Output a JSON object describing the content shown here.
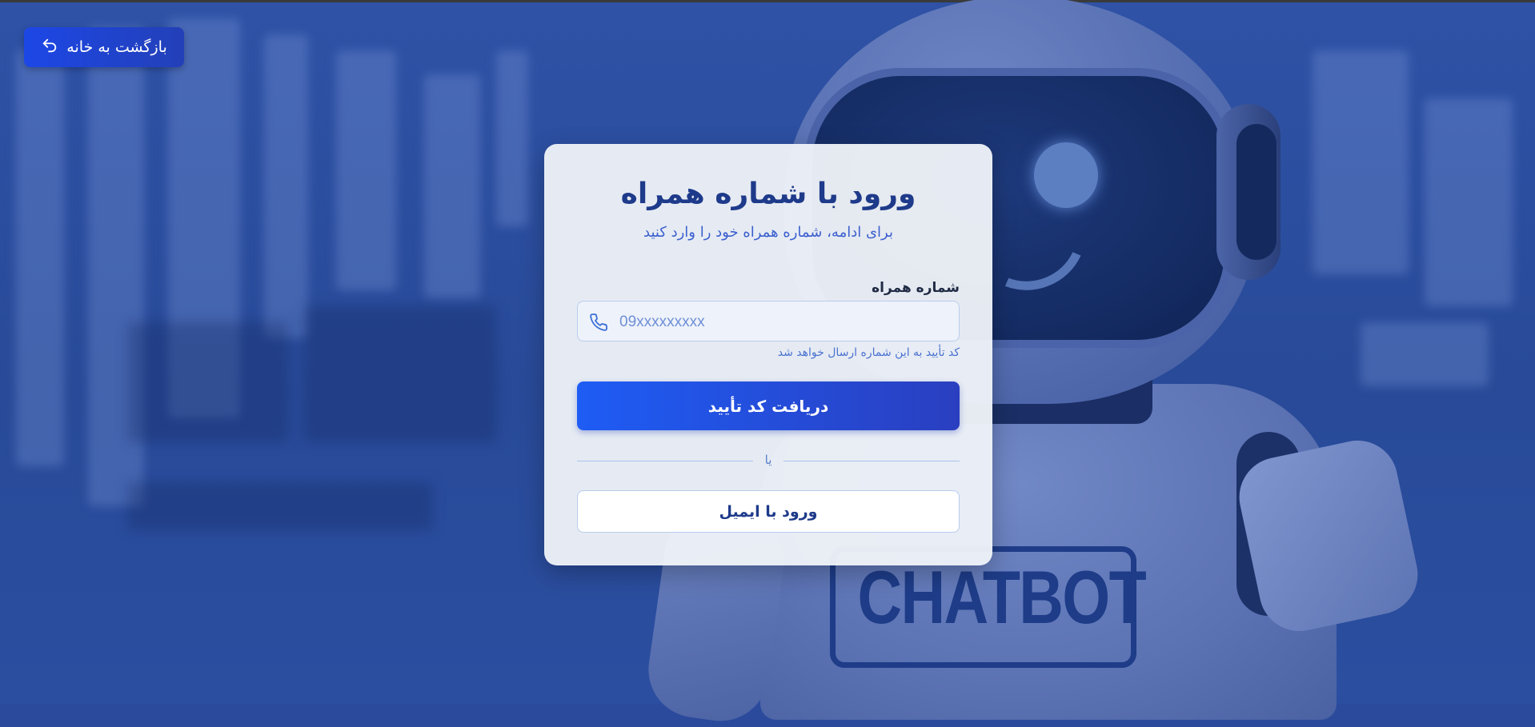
{
  "nav": {
    "back_label": "بازگشت به خانه",
    "back_icon": "undo-arrow-icon"
  },
  "login": {
    "title": "ورود با شماره همراه",
    "subtitle": "برای ادامه، شماره همراه خود را وارد کنید",
    "phone_label": "شماره همراه",
    "phone_placeholder": "09xxxxxxxxx",
    "phone_value": "",
    "phone_icon": "phone-icon",
    "hint": "کد تأیید به این شماره ارسال خواهد شد",
    "submit_label": "دریافت کد تأیید",
    "divider_label": "یا",
    "email_login_label": "ورود با ایمیل"
  },
  "background": {
    "robot_plate_text": "CHATBOT"
  },
  "colors": {
    "primary": "#1e5cf5",
    "primary_dark": "#2a3fc0",
    "title": "#1e3a8a",
    "accent_text": "#3b5fcf"
  }
}
